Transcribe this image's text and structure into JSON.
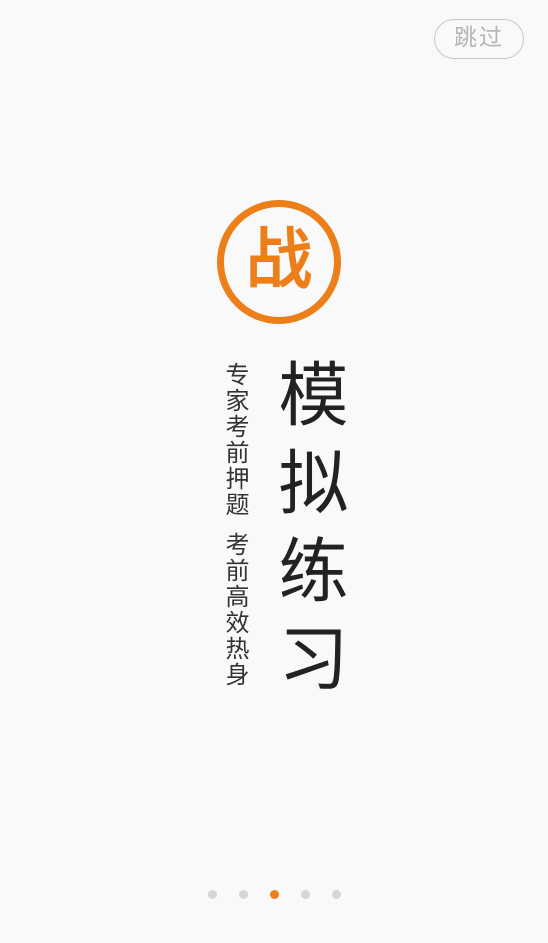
{
  "skip": {
    "label": "跳过"
  },
  "emblem": {
    "char": "战",
    "color": "#ec7f1a"
  },
  "title": "模拟练习",
  "subtitle": {
    "part1": "专家考前押题",
    "part2": "考前高效热身"
  },
  "pager": {
    "count": 5,
    "active_index": 2
  }
}
